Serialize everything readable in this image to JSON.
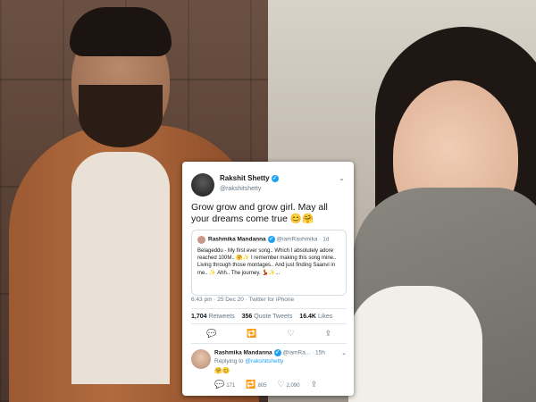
{
  "tweet": {
    "author_name": "Rakshit Shetty",
    "author_handle": "@rakshitshetty",
    "text": "Grow grow and grow girl. May all your dreams come true 😊🤗",
    "quote": {
      "author_name": "Rashmika Mandanna",
      "author_handle": "@iamRashmika · 1d",
      "text": "Belageddu - My first ever song.. Which I absolutely adore reached 100M.. 🤗✨ I remember making this song mine.. Living through those montages.. And just finding Saanvi in me.. ✨ Ahh.. The journey. 💃✨..."
    },
    "meta": "6:43 pm · 25 Dec 20 · Twitter for iPhone",
    "stats": {
      "retweets_count": "1,704",
      "retweets_label": "Retweets",
      "quote_count": "356",
      "quote_label": "Quote Tweets",
      "likes_count": "16.4K",
      "likes_label": "Likes"
    },
    "actions": [
      "💬",
      "🔁",
      "♡",
      "⇪"
    ],
    "reply": {
      "author_name": "Rashmika Mandanna",
      "author_handle": "@iamRa... · 15h",
      "replying_prefix": "Replying to",
      "replying_to": "@rakshitshetty",
      "text": "🤗😊",
      "reply_count": "171",
      "retweet_count": "805",
      "like_count": "2,090"
    }
  },
  "colors": {
    "twitter_blue": "#1da1f2",
    "meta_gray": "#657786"
  }
}
